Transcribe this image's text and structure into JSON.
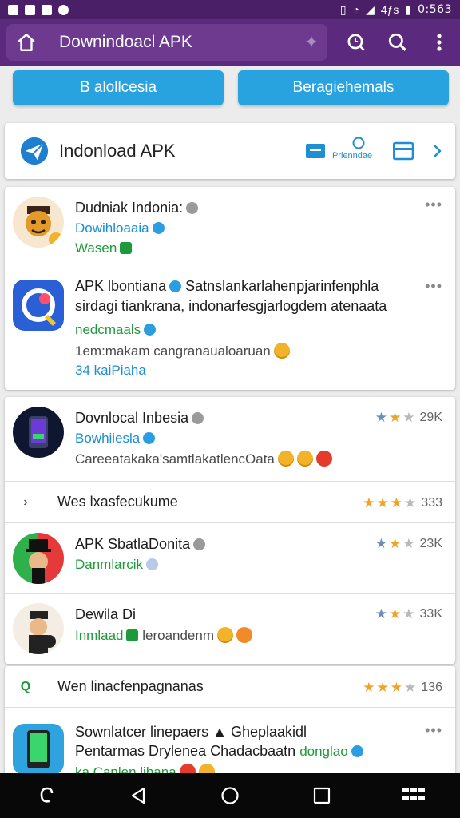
{
  "status_bar": {
    "time": "0:563",
    "carrier": "4ƒs"
  },
  "app_bar": {
    "search_title": "Downindoacl APK",
    "icons": [
      "home-icon",
      "sparkle-icon",
      "lens-icon",
      "search-icon",
      "more-vert-icon"
    ]
  },
  "top_buttons": [
    {
      "label": "B alollcesia"
    },
    {
      "label": "Beragiehemals"
    }
  ],
  "header_card": {
    "title": "Indonload APK",
    "chip": "Prienndae"
  },
  "items": [
    {
      "name": "Dudniak Indonia:",
      "line2": "Dowihloaaia",
      "line3": "Wasen",
      "menu": "•••"
    },
    {
      "name": "APK lbontiana",
      "name_rest": "Satnslankarlahenpjarinfenphla",
      "line2": "sirdagi tiankrana, indonarfesgjarlogdem atenaata",
      "line3": "nedcmaals",
      "line4": "1em:makam cangranaualoaruan",
      "line5": "34 kaiPiaha",
      "menu": "•••"
    }
  ],
  "group2": [
    {
      "name": "Dovnlocal Inbesia",
      "line2": "Bowhiiesla",
      "line3": "Careeatakaka'samtlakatlencOata",
      "rating_text": "29K"
    },
    {
      "sub": "Wes lxasfecukume",
      "rating_text": "333",
      "lead": "›"
    },
    {
      "name": "APK SbatlaDonita",
      "line2": "Danmlarcik",
      "rating_text": "23K"
    },
    {
      "name": "Dewila Di",
      "line2a": "Inmlaad",
      "line2b": "leroandenm",
      "rating_text": "33K"
    }
  ],
  "group3": [
    {
      "sub": "Wen linacfenpagnanas",
      "rating_text": "136",
      "lead": "Q"
    },
    {
      "name": "Sownlatcer linepaers",
      "name_rest": "Gheplaakidl",
      "line2": "Pentarmas Drylenea Chadacbaatn",
      "line2_tail": "donglao",
      "line3": "ka Canlen lihana",
      "menu": "•••"
    }
  ]
}
